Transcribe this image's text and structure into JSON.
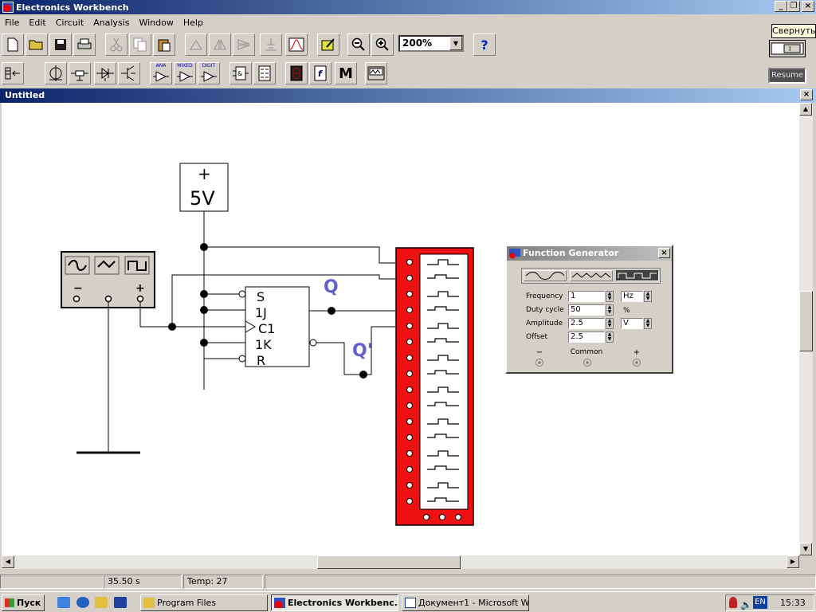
{
  "window": {
    "title": "Electronics Workbench",
    "minimize_glyph": "_",
    "restore_glyph": "❐",
    "close_glyph": "×"
  },
  "menu": [
    "File",
    "Edit",
    "Circuit",
    "Analysis",
    "Window",
    "Help"
  ],
  "toolbar": {
    "zoom_value": "200%",
    "help_glyph": "?",
    "tooltip": "Свернуть",
    "resume_label": "Resume",
    "parts_bin_labels": {
      "analog": "ANA",
      "mixed": "MIXED",
      "digital": "DIGIT",
      "misc": "M",
      "func": "f"
    }
  },
  "document": {
    "title": "Untitled",
    "close_glyph": "×"
  },
  "circuit": {
    "battery_plus": "+",
    "battery_label": "5V",
    "ff_pins": [
      "S",
      "1J",
      "C1",
      "1K",
      "R"
    ],
    "q_label": "Q",
    "qbar_label": "Q'",
    "fg_minus": "−",
    "fg_plus": "+"
  },
  "function_generator": {
    "title": "Function Generator",
    "close_glyph": "×",
    "fields": [
      {
        "label": "Frequency",
        "value": "1",
        "unit": "Hz"
      },
      {
        "label": "Duty cycle",
        "value": "50",
        "unit": "%"
      },
      {
        "label": "Amplitude",
        "value": "2.5",
        "unit": "V"
      },
      {
        "label": "Offset",
        "value": "2.5",
        "unit": ""
      }
    ],
    "terminals": {
      "minus": "−",
      "common": "Common",
      "plus": "+"
    },
    "selected_waveform": "square"
  },
  "status": {
    "time": "35.50 s",
    "temp": "Temp:  27"
  },
  "taskbar": {
    "start": "Пуск",
    "tasks": [
      "Program Files",
      "Electronics Workbenc...",
      "Документ1 - Microsoft W..."
    ],
    "lang": "EN",
    "clock": "15:33"
  }
}
